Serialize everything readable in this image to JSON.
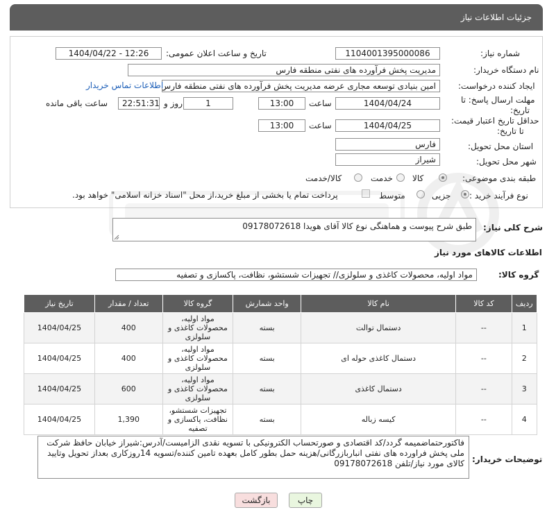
{
  "header": {
    "title": "جزئیات اطلاعات نیاز"
  },
  "form": {
    "need_number_label": "شماره نیاز:",
    "need_number": "1104001395000086",
    "announce_label": "تاریخ و ساعت اعلان عمومی:",
    "announce_value": "1404/04/22 - 12:26",
    "buyer_label": "نام دستگاه خریدار:",
    "buyer_value": "مدیریت پخش فرآورده های نفتی منطقه فارس",
    "creator_label": "ایجاد کننده درخواست:",
    "creator_value": "امین بنیادی توسعه مجاری عرضه مدیریت پخش فرآورده های نفتی منطقه فارس",
    "contact_link": "اطلاعات تماس خریدار",
    "deadline_label_1": "مهلت ارسال پاسخ: تا",
    "deadline_label_2": "تاریخ:",
    "deadline_date": "1404/04/24",
    "time_label": "ساعت",
    "deadline_time": "13:00",
    "days_value": "1",
    "days_label": "روز و",
    "remaining_time": "22:51:31",
    "remaining_label": "ساعت باقی مانده",
    "validity_label_1": "حداقل تاریخ اعتبار قیمت:",
    "validity_label_2": "تا تاریخ:",
    "validity_date": "1404/04/25",
    "validity_time": "13:00",
    "province_label": "استان محل تحویل:",
    "province_value": "فارس",
    "city_label": "شهر محل تحویل:",
    "city_value": "شیراز",
    "category_label": "طبقه بندی موضوعی:",
    "category_options": [
      "کالا",
      "خدمت",
      "کالا/خدمت"
    ],
    "category_selected": "کالا",
    "process_label": "نوع فرآیند خرید :",
    "process_options": [
      "جزیی",
      "متوسط"
    ],
    "process_selected": "جزیی",
    "payment_note": "پرداخت تمام یا بخشی از مبلغ خرید،از محل \"اسناد خزانه اسلامی\" خواهد بود."
  },
  "summary": {
    "label": "شرح کلی نیاز:",
    "value": "طبق شرح پیوست و هماهنگی نوع کالا آقای هویدا 09178072618"
  },
  "goods_section_title": "اطلاعات کالاهای مورد نیاز",
  "goods_group": {
    "label": "گروه کالا:",
    "value": "مواد اولیه، محصولات کاغذی و سلولزی// تجهیزات شستشو، نظافت، پاکسازی و تصفیه"
  },
  "table": {
    "headers": [
      "ردیف",
      "کد کالا",
      "نام کالا",
      "واحد شمارش",
      "گروه کالا",
      "تعداد / مقدار",
      "تاریخ نیاز"
    ],
    "rows": [
      {
        "index": "1",
        "code": "--",
        "name": "دستمال توالت",
        "unit": "بسته",
        "group": "مواد اولیه، محصولات کاغذی و سلولزی",
        "qty": "400",
        "date": "1404/04/25"
      },
      {
        "index": "2",
        "code": "--",
        "name": "دستمال کاغذی حوله ای",
        "unit": "بسته",
        "group": "مواد اولیه، محصولات کاغذی و سلولزی",
        "qty": "400",
        "date": "1404/04/25"
      },
      {
        "index": "3",
        "code": "--",
        "name": "دستمال کاغذی",
        "unit": "بسته",
        "group": "مواد اولیه، محصولات کاغذی و سلولزی",
        "qty": "600",
        "date": "1404/04/25"
      },
      {
        "index": "4",
        "code": "--",
        "name": "کیسه زباله",
        "unit": "بسته",
        "group": "تجهیزات شستشو، نظافت، پاکسازی و تصفیه",
        "qty": "1,390",
        "date": "1404/04/25"
      }
    ]
  },
  "buyer_notes": {
    "label": "توضیحات خریدار:",
    "value": "فاکتورحتماضمیمه گردد/کد اقتصادی و صورتحساب الکترونیکی با تسویه نقدی الزامیست/آدرس:شیراز خیابان حافظ شرکت ملی پخش فراورده های نفتی انباربازرگانی/هزینه حمل بطور کامل بعهده تامین کننده/تسویه 14روزکاری بعداز تحویل وتایید کالای مورد نیاز/تلفن 09178072618"
  },
  "buttons": {
    "print": "چاپ",
    "back": "بازگشت"
  },
  "colors": {
    "header_bg": "#5d5d5d",
    "link": "#1d5fb8",
    "back_button_bg": "#f8dede",
    "print_button_bg": "#e9f6df"
  }
}
